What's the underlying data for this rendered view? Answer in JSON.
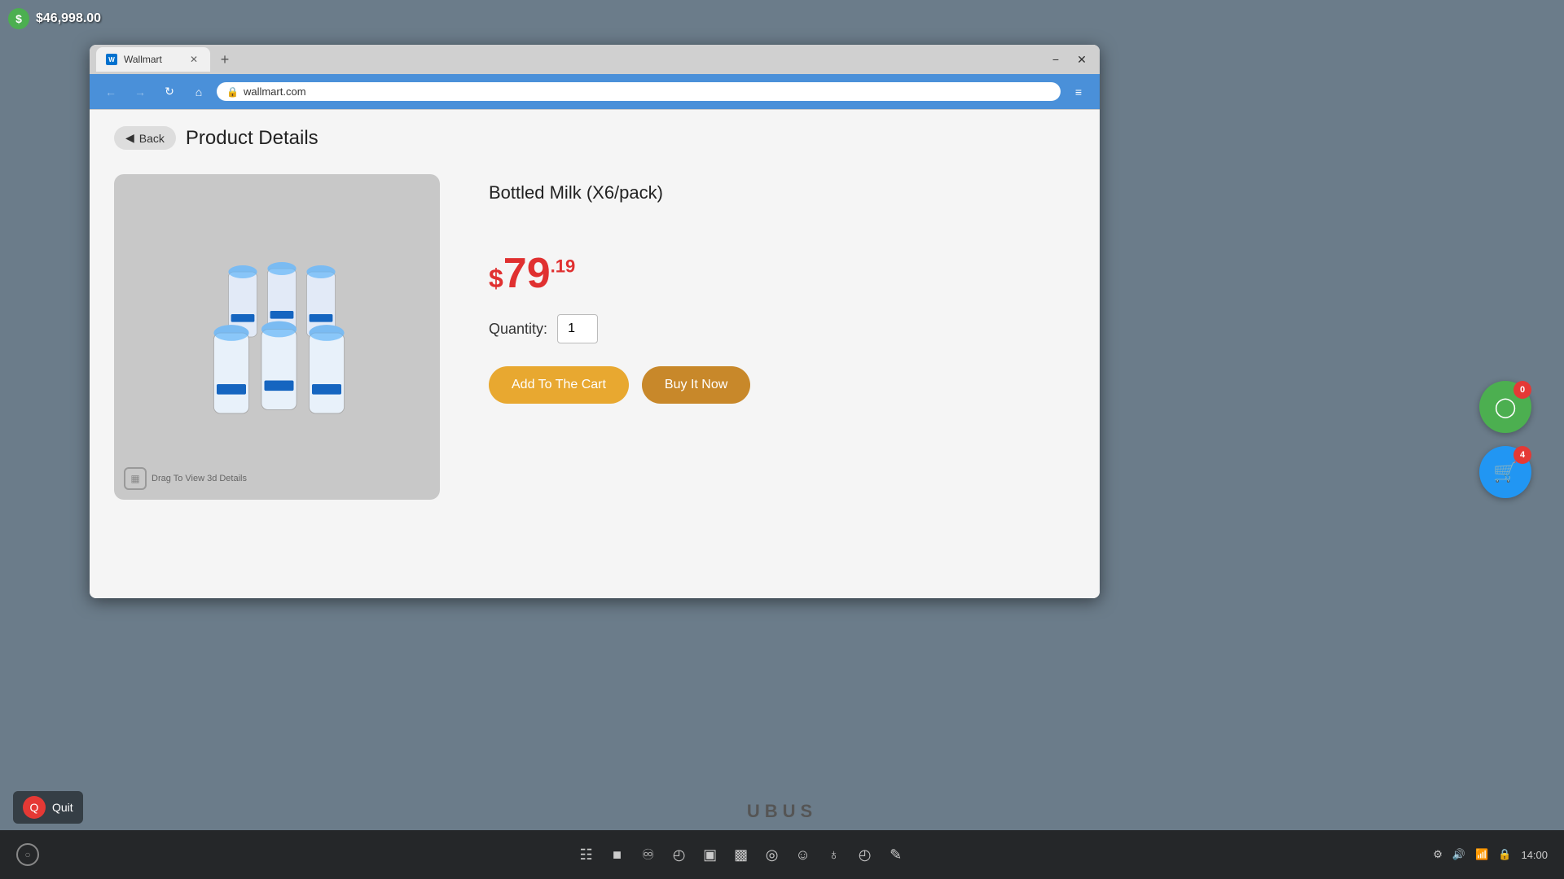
{
  "taskbar": {
    "money_icon": "$",
    "money_amount": "$46,998.00",
    "time": "14:00",
    "ubus_brand": "UBUS"
  },
  "browser": {
    "tab_label": "Wallmart",
    "url": "wallmart.com",
    "new_tab_label": "+",
    "minimize_label": "−",
    "close_label": "✕"
  },
  "page": {
    "back_label": "Back",
    "title": "Product Details",
    "product_name": "Bottled Milk (X6/pack)",
    "price_whole": "79",
    "price_decimal": ".19",
    "price_symbol": "$",
    "quantity_label": "Quantity:",
    "quantity_value": "1",
    "add_to_cart_label": "Add To The Cart",
    "buy_it_now_label": "Buy It Now",
    "drag_hint": "Drag To View 3d Details"
  },
  "fab": {
    "inventory_badge": "0",
    "cart_badge": "4"
  },
  "quit": {
    "icon": "Q",
    "label": "Quit"
  }
}
